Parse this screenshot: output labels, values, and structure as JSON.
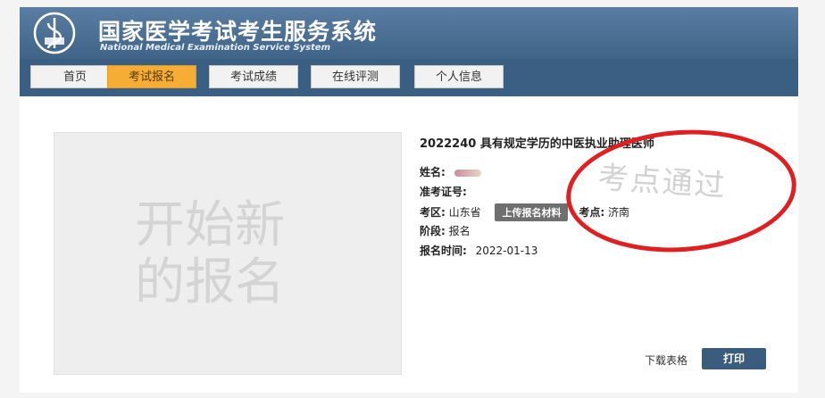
{
  "header": {
    "title_cn": "国家医学考试考生服务系统",
    "title_en": "National Medical Examination Service System"
  },
  "nav": {
    "tabs": [
      {
        "label": "首页"
      },
      {
        "label": "考试报名"
      },
      {
        "label": "考试成绩"
      },
      {
        "label": "在线评测"
      },
      {
        "label": "个人信息"
      }
    ],
    "active_index": 1
  },
  "new_registration": {
    "line1": "开始新",
    "line2": "的报名"
  },
  "exam": {
    "title": "2022240 具有规定学历的中医执业助理医师",
    "name_label": "姓名:",
    "ticket_label": "准考证号:",
    "district_label": "考区:",
    "district_value": "山东省",
    "upload_label": "上传报名材料",
    "site_label": "考点:",
    "site_value": "济南",
    "stage_label": "阶段:",
    "stage_value": "报名",
    "time_label": "报名时间:",
    "time_value": "2022-01-13",
    "stamp_text": "考点通过"
  },
  "actions": {
    "download": "下载表格",
    "print": "打印"
  },
  "colors": {
    "header_bg": "#4a6e92",
    "nav_bg": "#3b5f83",
    "active_tab": "#f6ad36",
    "circle": "#e02020",
    "print_btn": "#3a5d7d"
  }
}
